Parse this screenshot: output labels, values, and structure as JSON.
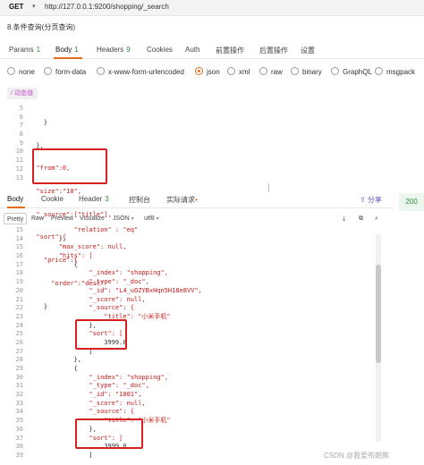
{
  "request": {
    "method": "GET",
    "url": "http://127.0.0.1:9200/shopping/_search",
    "name": "8.条件查询(分页查询)"
  },
  "tabs": [
    {
      "label": "Params",
      "count": "1"
    },
    {
      "label": "Body",
      "count": "1"
    },
    {
      "label": "Headers",
      "count": "9"
    },
    {
      "label": "Cookies",
      "count": ""
    },
    {
      "label": "Auth",
      "count": ""
    },
    {
      "label": "前置操作",
      "count": ""
    },
    {
      "label": "后置操作",
      "count": ""
    },
    {
      "label": "设置",
      "count": ""
    }
  ],
  "body_types": [
    "none",
    "form-data",
    "x-www-form-urlencoded",
    "json",
    "xml",
    "raw",
    "binary",
    "GraphQL",
    "msgpack"
  ],
  "body_type_selected": "json",
  "beautify_label": "⁄ 动态值",
  "request_code": {
    "line_numbers": [
      "5",
      "6",
      "7",
      "8",
      "9",
      "10",
      "11",
      "12",
      "13"
    ],
    "lines": [
      "    }",
      "  },",
      "  \"from\":0,",
      "  \"size\":\"10\",",
      "  \"_source\":[\"title\"],",
      "  \"sort\":{",
      "    \"price\":{",
      "      \"order\":\"desc\"",
      "    }"
    ]
  },
  "response": {
    "tabs": [
      {
        "label": "Body",
        "count": ""
      },
      {
        "label": "Cookie",
        "count": ""
      },
      {
        "label": "Header",
        "count": "3"
      },
      {
        "label": "控制台",
        "count": ""
      },
      {
        "label": "实际请求",
        "count": "•"
      }
    ],
    "share_label": "分享",
    "status": "200",
    "toolbar": [
      "Pretty",
      "Raw",
      "Preview",
      "Visualize",
      "JSON",
      "utf8"
    ],
    "line_numbers": [
      "15",
      "14",
      "15",
      "16",
      "17",
      "18",
      "19",
      "20",
      "21",
      "22",
      "23",
      "24",
      "25",
      "26",
      "27",
      "28",
      "29",
      "30",
      "31",
      "32",
      "33",
      "34",
      "35",
      "36",
      "37",
      "38",
      "39"
    ],
    "lines": [
      "            \"relation\" : \"eq\"",
      "        },",
      "        \"max_score\": null,",
      "        \"hits\": [",
      "            {",
      "                \"_index\": \"shopping\",",
      "                \"_type\": \"_doc\",",
      "                \"_id\": \"L4_uOZYBxHqn5H18e8VV\",",
      "                \"_score\": null,",
      "                \"_source\": {",
      "                    \"title\": \"小米手机\"",
      "                },",
      "                \"sort\": [",
      "                    3999.0",
      "                ]",
      "            },",
      "            {",
      "                \"_index\": \"shopping\",",
      "                \"_type\": \"_doc\",",
      "                \"_id\": \"1001\",",
      "                \"_score\": null,",
      "                \"_source\": {",
      "                    \"title\": \"小米手机\"",
      "                },",
      "                \"sort\": [",
      "                    3999.0",
      "                ]"
    ]
  },
  "watermark": "CSDN @我爱布朗熊",
  "colors": {
    "accent": "#e56c1a",
    "highlight_box": "#d61f1f",
    "string": "#c41a16",
    "status_ok": "#2e8a3f"
  }
}
